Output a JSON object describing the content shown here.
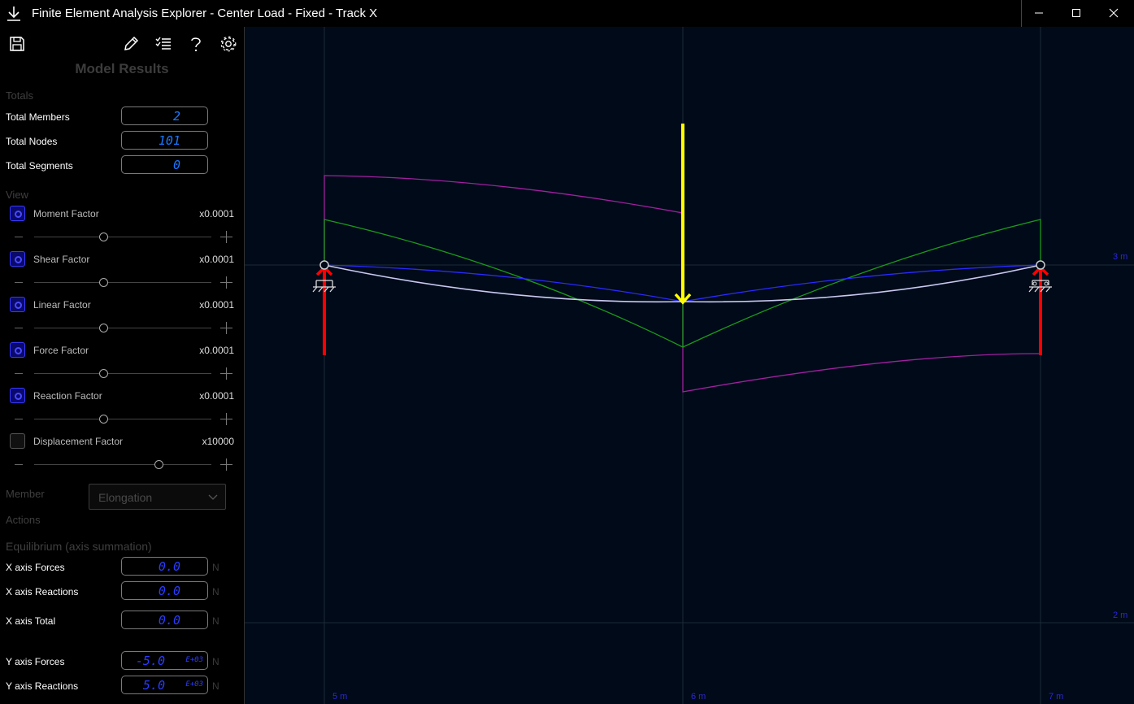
{
  "window": {
    "title": "Finite Element Analysis Explorer - Center Load - Fixed - Track X",
    "icon": "download-arrow-icon",
    "controls": [
      "minimize-icon",
      "maximize-icon",
      "close-icon"
    ]
  },
  "toolbar": {
    "icons": [
      "save-icon",
      "pencil-icon",
      "checklist-icon",
      "help-icon",
      "gear-icon"
    ]
  },
  "panel": {
    "title": "Model Results",
    "totals_label": "Totals",
    "totals": [
      {
        "label": "Total Members",
        "value": "2"
      },
      {
        "label": "Total Nodes",
        "value": "101"
      },
      {
        "label": "Total Segments",
        "value": "0"
      }
    ],
    "view_label": "View",
    "factors": [
      {
        "label": "Moment Factor",
        "value": "x0.0001",
        "checked": true,
        "level": 0.39
      },
      {
        "label": "Shear Factor",
        "value": "x0.0001",
        "checked": true,
        "level": 0.39
      },
      {
        "label": "Linear Factor",
        "value": "x0.0001",
        "checked": true,
        "level": 0.39
      },
      {
        "label": "Force Factor",
        "value": "x0.0001",
        "checked": true,
        "level": 0.39
      },
      {
        "label": "Reaction Factor",
        "value": "x0.0001",
        "checked": true,
        "level": 0.39
      },
      {
        "label": "Displacement Factor",
        "value": "x10000",
        "checked": false,
        "level": 0.7
      }
    ],
    "member_label": "Member",
    "member_select": "Elongation",
    "actions_label": "Actions",
    "equilibrium_label": "Equilibrium (axis summation)",
    "equilibrium": [
      {
        "label": "X axis Forces",
        "value": "0.0",
        "exp": "",
        "unit": "N"
      },
      {
        "label": "X axis Reactions",
        "value": "0.0",
        "exp": "",
        "unit": "N"
      },
      {
        "label": "X axis Total",
        "value": "0.0",
        "exp": "",
        "unit": "N"
      },
      {
        "label": "Y axis Forces",
        "value": "-5.0",
        "exp": "E+03",
        "unit": "N"
      },
      {
        "label": "Y axis Reactions",
        "value": "5.0",
        "exp": "E+03",
        "unit": "N"
      }
    ]
  },
  "canvas": {
    "grid_labels": {
      "x": [
        "5 m",
        "6 m",
        "7 m"
      ],
      "y": [
        "3 m",
        "2 m"
      ]
    },
    "colors": {
      "background": "#000a19",
      "grid": "#1e2a38",
      "moment": "#a020a0",
      "shear": "#1a9a1a",
      "beam": "#2a2aff",
      "load": "#ffff00",
      "reaction": "#ff0000"
    }
  }
}
